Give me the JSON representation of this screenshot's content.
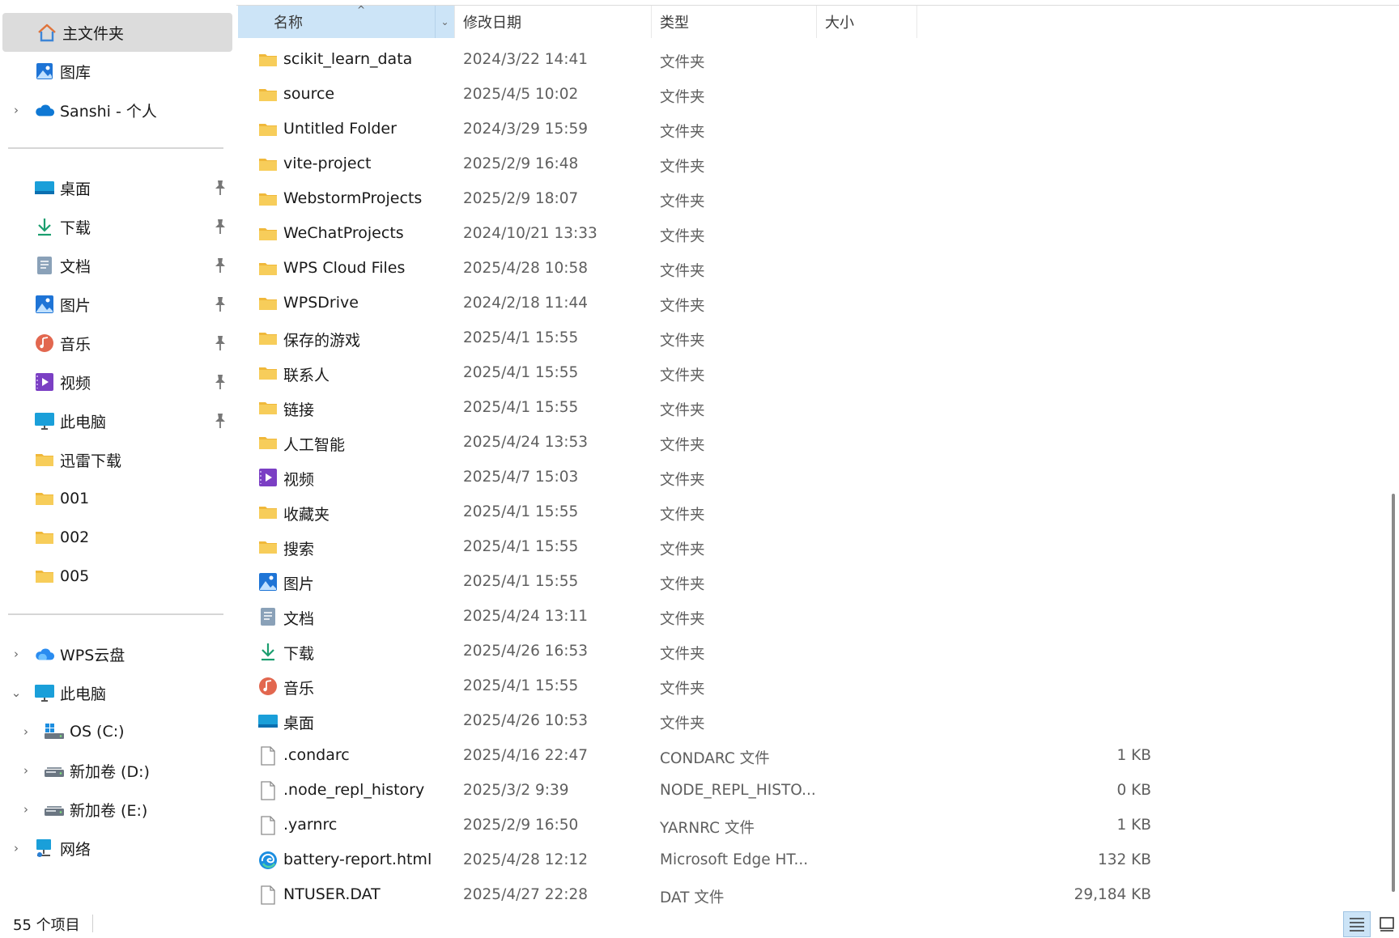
{
  "sidebar": {
    "home": "主文件夹",
    "gallery": "图库",
    "onedrive": "Sanshi - 个人",
    "quick_access": [
      {
        "label": "桌面",
        "icon": "desktop-icon"
      },
      {
        "label": "下载",
        "icon": "download-icon"
      },
      {
        "label": "文档",
        "icon": "document-icon"
      },
      {
        "label": "图片",
        "icon": "pictures-icon"
      },
      {
        "label": "音乐",
        "icon": "music-icon"
      },
      {
        "label": "视频",
        "icon": "video-icon"
      },
      {
        "label": "此电脑",
        "icon": "monitor-icon"
      },
      {
        "label": "迅雷下载",
        "icon": "folder-icon"
      },
      {
        "label": "001",
        "icon": "folder-icon"
      },
      {
        "label": "002",
        "icon": "folder-icon"
      },
      {
        "label": "005",
        "icon": "folder-icon"
      }
    ],
    "wps_cloud": "WPS云盘",
    "this_pc": "此电脑",
    "drives": [
      {
        "label": "OS (C:)"
      },
      {
        "label": "新加卷 (D:)"
      },
      {
        "label": "新加卷 (E:)"
      }
    ],
    "network": "网络"
  },
  "columns": {
    "name": "名称",
    "date": "修改日期",
    "type": "类型",
    "size": "大小"
  },
  "files": [
    {
      "name": "scikit_learn_data",
      "date": "2024/3/22 14:41",
      "type": "文件夹",
      "size": "",
      "icon": "folder"
    },
    {
      "name": "source",
      "date": "2025/4/5 10:02",
      "type": "文件夹",
      "size": "",
      "icon": "folder"
    },
    {
      "name": "Untitled Folder",
      "date": "2024/3/29 15:59",
      "type": "文件夹",
      "size": "",
      "icon": "folder"
    },
    {
      "name": "vite-project",
      "date": "2025/2/9 16:48",
      "type": "文件夹",
      "size": "",
      "icon": "folder"
    },
    {
      "name": "WebstormProjects",
      "date": "2025/2/9 18:07",
      "type": "文件夹",
      "size": "",
      "icon": "folder"
    },
    {
      "name": "WeChatProjects",
      "date": "2024/10/21 13:33",
      "type": "文件夹",
      "size": "",
      "icon": "folder"
    },
    {
      "name": "WPS Cloud Files",
      "date": "2025/4/28 10:58",
      "type": "文件夹",
      "size": "",
      "icon": "folder"
    },
    {
      "name": "WPSDrive",
      "date": "2024/2/18 11:44",
      "type": "文件夹",
      "size": "",
      "icon": "folder"
    },
    {
      "name": "保存的游戏",
      "date": "2025/4/1 15:55",
      "type": "文件夹",
      "size": "",
      "icon": "folder"
    },
    {
      "name": "联系人",
      "date": "2025/4/1 15:55",
      "type": "文件夹",
      "size": "",
      "icon": "folder"
    },
    {
      "name": "链接",
      "date": "2025/4/1 15:55",
      "type": "文件夹",
      "size": "",
      "icon": "folder"
    },
    {
      "name": "人工智能",
      "date": "2025/4/24 13:53",
      "type": "文件夹",
      "size": "",
      "icon": "folder"
    },
    {
      "name": "视频",
      "date": "2025/4/7 15:03",
      "type": "文件夹",
      "size": "",
      "icon": "video"
    },
    {
      "name": "收藏夹",
      "date": "2025/4/1 15:55",
      "type": "文件夹",
      "size": "",
      "icon": "folder"
    },
    {
      "name": "搜索",
      "date": "2025/4/1 15:55",
      "type": "文件夹",
      "size": "",
      "icon": "folder"
    },
    {
      "name": "图片",
      "date": "2025/4/1 15:55",
      "type": "文件夹",
      "size": "",
      "icon": "pictures"
    },
    {
      "name": "文档",
      "date": "2025/4/24 13:11",
      "type": "文件夹",
      "size": "",
      "icon": "document"
    },
    {
      "name": "下载",
      "date": "2025/4/26 16:53",
      "type": "文件夹",
      "size": "",
      "icon": "download"
    },
    {
      "name": "音乐",
      "date": "2025/4/1 15:55",
      "type": "文件夹",
      "size": "",
      "icon": "music"
    },
    {
      "name": "桌面",
      "date": "2025/4/26 10:53",
      "type": "文件夹",
      "size": "",
      "icon": "desktop"
    },
    {
      "name": ".condarc",
      "date": "2025/4/16 22:47",
      "type": "CONDARC 文件",
      "size": "1 KB",
      "icon": "file"
    },
    {
      "name": ".node_repl_history",
      "date": "2025/3/2 9:39",
      "type": "NODE_REPL_HISTO...",
      "size": "0 KB",
      "icon": "file"
    },
    {
      "name": ".yarnrc",
      "date": "2025/2/9 16:50",
      "type": "YARNRC 文件",
      "size": "1 KB",
      "icon": "file"
    },
    {
      "name": "battery-report.html",
      "date": "2025/4/28 12:12",
      "type": "Microsoft Edge HT...",
      "size": "132 KB",
      "icon": "edge"
    },
    {
      "name": "NTUSER.DAT",
      "date": "2025/4/27 22:28",
      "type": "DAT 文件",
      "size": "29,184 KB",
      "icon": "file"
    }
  ],
  "status": {
    "item_count": "55 个项目"
  },
  "colors": {
    "folder": "#f7c948",
    "selection": "#cce4f7",
    "sidebar_selected": "#dcdcdc"
  }
}
